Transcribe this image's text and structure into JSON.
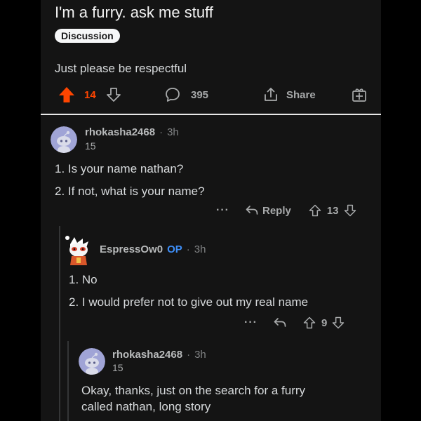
{
  "post": {
    "title": "I'm a furry. ask me stuff",
    "flair": "Discussion",
    "body": "Just please be respectful",
    "upvotes": "14",
    "comments": "395",
    "share_label": "Share"
  },
  "comments": [
    {
      "username": "rhokasha2468",
      "separator": "·",
      "time": "3h",
      "user_flair": "15",
      "lines": [
        "1. Is your name nathan?",
        "2. If not, what is your name?"
      ],
      "more": "···",
      "reply_label": "Reply",
      "votes": "13"
    },
    {
      "username": "EspressOw0",
      "op_badge": "OP",
      "separator": "·",
      "time": "3h",
      "lines": [
        "1. No",
        "2. I would prefer not to give out my real name"
      ],
      "more": "···",
      "votes": "9"
    },
    {
      "username": "rhokasha2468",
      "separator": "·",
      "time": "3h",
      "user_flair": "15",
      "lines": [
        "Okay, thanks, just on the search for a furry",
        "called nathan, long story"
      ]
    }
  ],
  "colors": {
    "background": "#141414",
    "upvote_active": "#ff4500",
    "op_badge": "#3e8ef7",
    "text_muted": "#818384"
  }
}
